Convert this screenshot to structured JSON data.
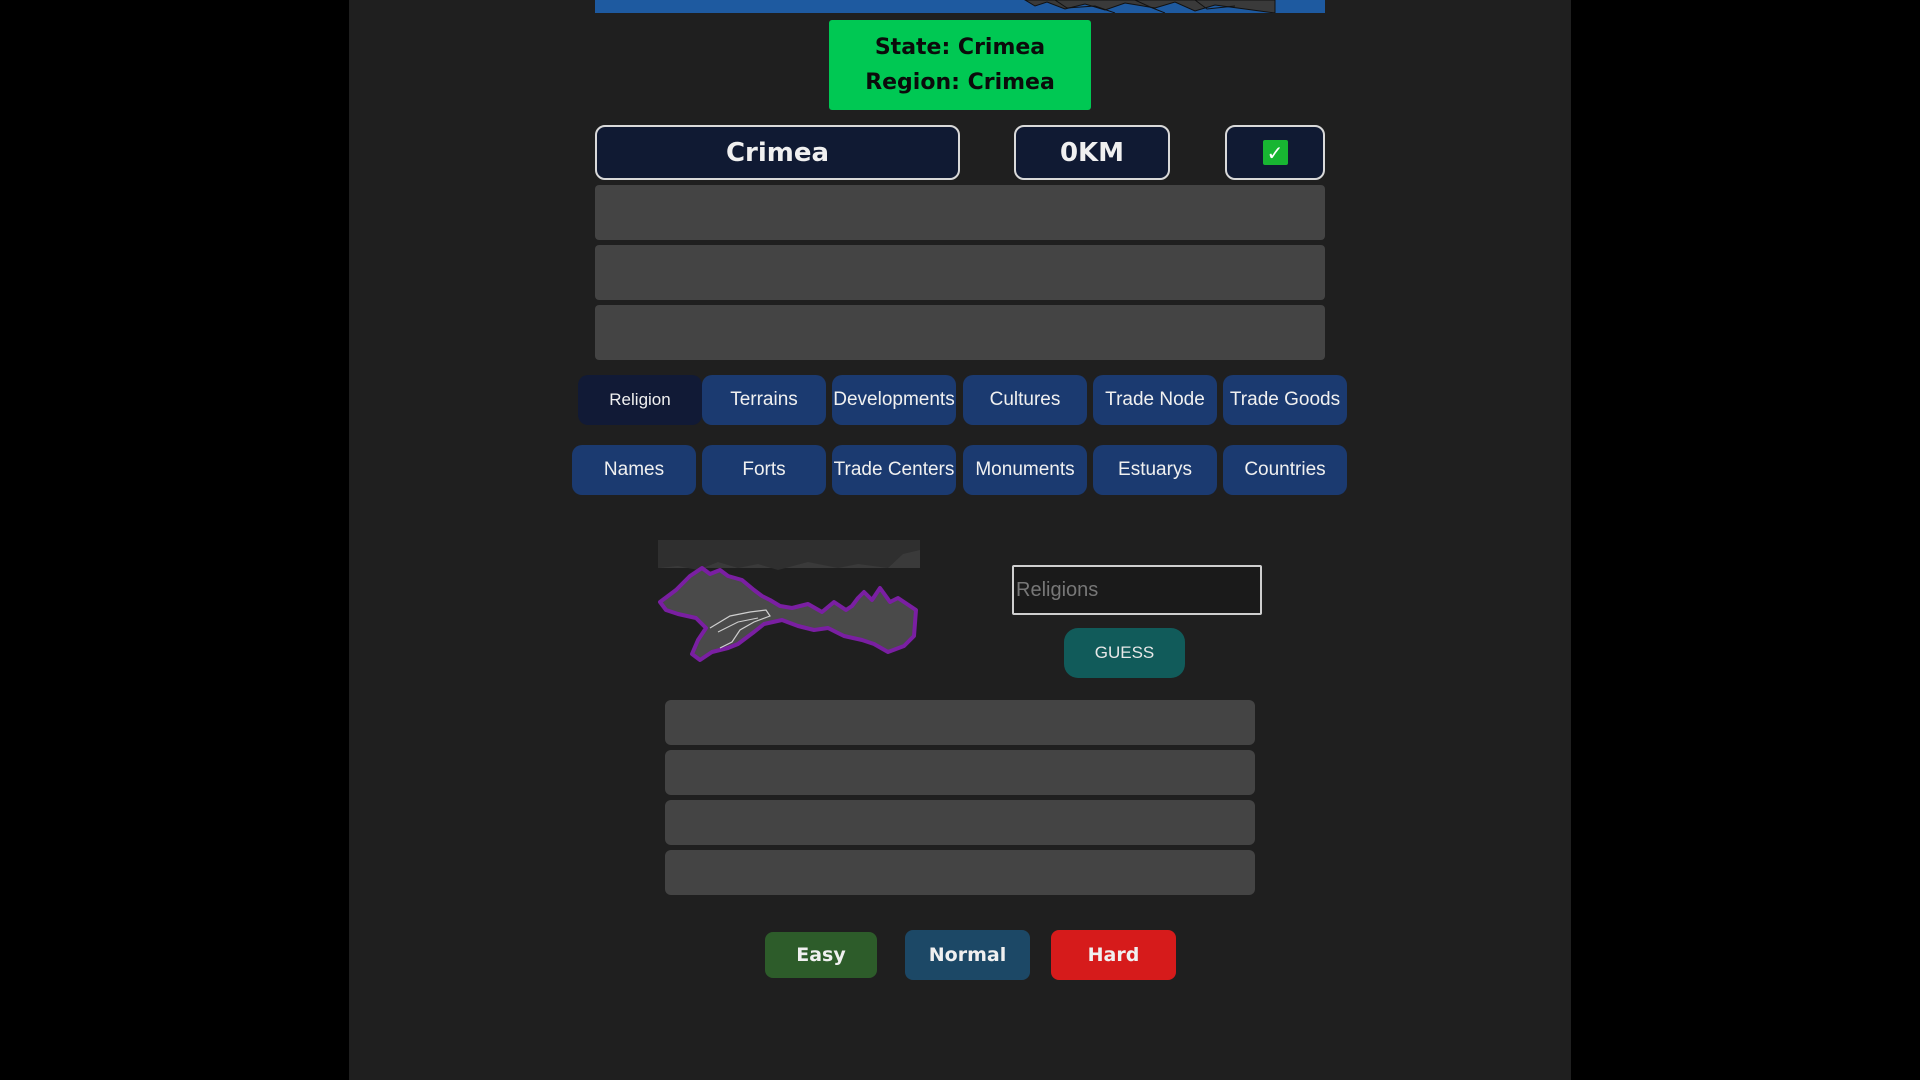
{
  "header": {
    "state_line": "State: Crimea",
    "region_line": "Region: Crimea"
  },
  "result": {
    "guessed_name": "Crimea",
    "distance": "0KM",
    "correct_icon": "checkmark-icon",
    "check_glyph": "✓"
  },
  "categories": {
    "row1": [
      "Religion",
      "Terrains",
      "Developments",
      "Cultures",
      "Trade Node",
      "Trade Goods"
    ],
    "row2": [
      "Names",
      "Forts",
      "Trade Centers",
      "Monuments",
      "Estuarys",
      "Countries"
    ],
    "active": "Religion"
  },
  "guess": {
    "placeholder": "Religions",
    "button_label": "GUESS"
  },
  "difficulty": {
    "easy": "Easy",
    "normal": "Normal",
    "hard": "Hard"
  },
  "colors": {
    "state_box": "#00c853",
    "category_button": "#1b3a70",
    "category_active": "#111a36",
    "guess_button": "#115b5a",
    "easy": "#2d5c2a",
    "normal": "#1c4866",
    "hard": "#d61b1b",
    "province_outline": "#7a1fa2"
  }
}
